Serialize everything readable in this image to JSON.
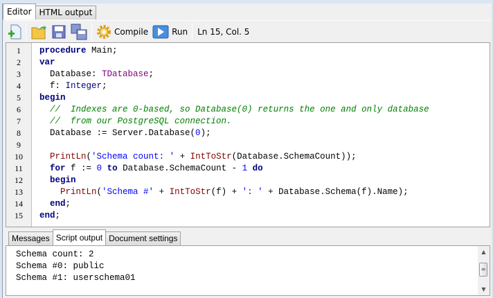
{
  "tabs": [
    "Editor",
    "HTML output"
  ],
  "toolbar": {
    "compile": "Compile",
    "run": "Run",
    "status": "Ln 15, Col. 5"
  },
  "editor": {
    "lines": [
      [
        [
          "k",
          "procedure"
        ],
        [
          "p",
          " Main;"
        ]
      ],
      [
        [
          "k",
          "var"
        ]
      ],
      [
        [
          "p",
          "  Database: "
        ],
        [
          "t",
          "TDatabase"
        ],
        [
          "p",
          ";"
        ]
      ],
      [
        [
          "p",
          "  f: "
        ],
        [
          "y",
          "Integer"
        ],
        [
          "p",
          ";"
        ]
      ],
      [
        [
          "k",
          "begin"
        ]
      ],
      [
        [
          "p",
          "  "
        ],
        [
          "c",
          "//  Indexes are 0-based, so Database(0) returns the one and only database"
        ]
      ],
      [
        [
          "p",
          "  "
        ],
        [
          "c",
          "//  from our PostgreSQL connection."
        ]
      ],
      [
        [
          "p",
          "  Database := Server.Database("
        ],
        [
          "n",
          "0"
        ],
        [
          "p",
          ");"
        ]
      ],
      [],
      [
        [
          "p",
          "  "
        ],
        [
          "f",
          "PrintLn"
        ],
        [
          "p",
          "("
        ],
        [
          "s",
          "'Schema count: '"
        ],
        [
          "p",
          " + "
        ],
        [
          "f",
          "IntToStr"
        ],
        [
          "p",
          "(Database.SchemaCount));"
        ]
      ],
      [
        [
          "p",
          "  "
        ],
        [
          "k",
          "for"
        ],
        [
          "p",
          " f := "
        ],
        [
          "n",
          "0"
        ],
        [
          "p",
          " "
        ],
        [
          "k",
          "to"
        ],
        [
          "p",
          " Database.SchemaCount - "
        ],
        [
          "n",
          "1"
        ],
        [
          "p",
          " "
        ],
        [
          "k",
          "do"
        ]
      ],
      [
        [
          "p",
          "  "
        ],
        [
          "k",
          "begin"
        ]
      ],
      [
        [
          "p",
          "    "
        ],
        [
          "f",
          "PrintLn"
        ],
        [
          "p",
          "("
        ],
        [
          "s",
          "'Schema #'"
        ],
        [
          "p",
          " + "
        ],
        [
          "f",
          "IntToStr"
        ],
        [
          "p",
          "(f) + "
        ],
        [
          "s",
          "': '"
        ],
        [
          "p",
          " + Database.Schema(f).Name);"
        ]
      ],
      [
        [
          "p",
          "  "
        ],
        [
          "k",
          "end"
        ],
        [
          "p",
          ";"
        ]
      ],
      [
        [
          "k",
          "end"
        ],
        [
          "p",
          ";"
        ]
      ]
    ]
  },
  "bottom_tabs": [
    "Messages",
    "Script output",
    "Document settings"
  ],
  "output": [
    "Schema count: 2",
    "Schema #0: public",
    "Schema #1: userschema01"
  ]
}
